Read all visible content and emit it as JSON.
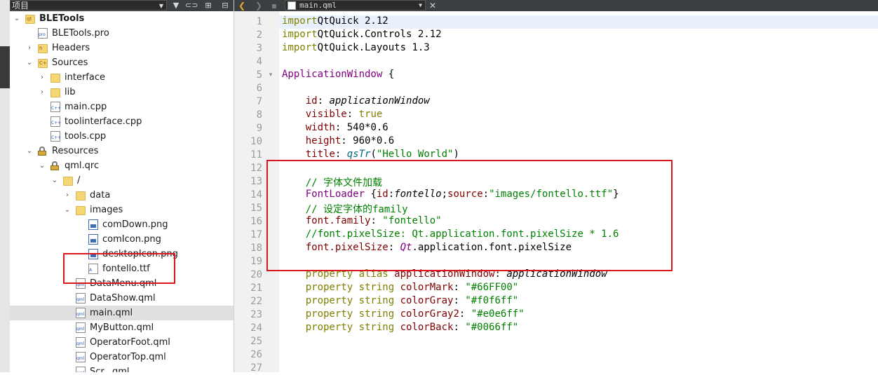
{
  "project_panel": {
    "title": "项目",
    "tree": [
      {
        "label": "BLETools",
        "depth": 0,
        "chev": "open",
        "icon": "project-icon",
        "bold": true
      },
      {
        "label": "BLETools.pro",
        "depth": 1,
        "chev": "none",
        "icon": "pro-file-icon"
      },
      {
        "label": "Headers",
        "depth": 1,
        "chev": "closed",
        "icon": "headers-icon"
      },
      {
        "label": "Sources",
        "depth": 1,
        "chev": "open",
        "icon": "sources-icon"
      },
      {
        "label": "interface",
        "depth": 2,
        "chev": "closed",
        "icon": "folder-icon"
      },
      {
        "label": "lib",
        "depth": 2,
        "chev": "closed",
        "icon": "folder-icon"
      },
      {
        "label": "main.cpp",
        "depth": 2,
        "chev": "none",
        "icon": "cpp-file-icon"
      },
      {
        "label": "toolinterface.cpp",
        "depth": 2,
        "chev": "none",
        "icon": "cpp-file-icon"
      },
      {
        "label": "tools.cpp",
        "depth": 2,
        "chev": "none",
        "icon": "cpp-file-icon"
      },
      {
        "label": "Resources",
        "depth": 1,
        "chev": "open",
        "icon": "resources-icon"
      },
      {
        "label": "qml.qrc",
        "depth": 2,
        "chev": "open",
        "icon": "qrc-file-icon"
      },
      {
        "label": "/",
        "depth": 3,
        "chev": "open",
        "icon": "folder-icon"
      },
      {
        "label": "data",
        "depth": 4,
        "chev": "closed",
        "icon": "folder-icon"
      },
      {
        "label": "images",
        "depth": 4,
        "chev": "open",
        "icon": "folder-icon"
      },
      {
        "label": "comDown.png",
        "depth": 5,
        "chev": "none",
        "icon": "image-file-icon"
      },
      {
        "label": "comIcon.png",
        "depth": 5,
        "chev": "none",
        "icon": "image-file-icon"
      },
      {
        "label": "desktopIcon.png",
        "depth": 5,
        "chev": "none",
        "icon": "image-file-icon"
      },
      {
        "label": "fontello.ttf",
        "depth": 5,
        "chev": "none",
        "icon": "font-file-icon"
      },
      {
        "label": "DataMenu.qml",
        "depth": 4,
        "chev": "none",
        "icon": "qml-file-icon"
      },
      {
        "label": "DataShow.qml",
        "depth": 4,
        "chev": "none",
        "icon": "qml-file-icon"
      },
      {
        "label": "main.qml",
        "depth": 4,
        "chev": "none",
        "icon": "qml-file-icon",
        "selected": true
      },
      {
        "label": "MyButton.qml",
        "depth": 4,
        "chev": "none",
        "icon": "qml-file-icon"
      },
      {
        "label": "OperatorFoot.qml",
        "depth": 4,
        "chev": "none",
        "icon": "qml-file-icon"
      },
      {
        "label": "OperatorTop.qml",
        "depth": 4,
        "chev": "none",
        "icon": "qml-file-icon"
      },
      {
        "label": "Scr...qml",
        "depth": 4,
        "chev": "none",
        "icon": "qml-file-icon"
      }
    ]
  },
  "editor": {
    "filename": "main.qml",
    "line_numbers": [
      "1",
      "2",
      "3",
      "4",
      "5",
      "6",
      "7",
      "8",
      "9",
      "10",
      "11",
      "12",
      "13",
      "14",
      "15",
      "16",
      "17",
      "18",
      "19",
      "20",
      "21",
      "22",
      "23",
      "24",
      "25",
      "26",
      "27"
    ],
    "fold_markers": {
      "5": "▾",
      "14": ""
    },
    "lines": [
      [
        [
          "kw",
          "import"
        ],
        [
          "",
          "QtQuick 2.12"
        ]
      ],
      [
        [
          "kw",
          "import"
        ],
        [
          "",
          "QtQuick.Controls 2.12"
        ]
      ],
      [
        [
          "kw",
          "import"
        ],
        [
          "",
          "QtQuick.Layouts 1.3"
        ]
      ],
      [],
      [
        [
          "ty",
          "ApplicationWindow"
        ],
        [
          "",
          " {"
        ]
      ],
      [],
      [
        [
          "",
          "    "
        ],
        [
          "pr",
          "id"
        ],
        [
          "",
          ": "
        ],
        [
          "it",
          "applicationWindow"
        ]
      ],
      [
        [
          "",
          "    "
        ],
        [
          "pr",
          "visible"
        ],
        [
          "",
          ": "
        ],
        [
          "kw",
          "true"
        ]
      ],
      [
        [
          "",
          "    "
        ],
        [
          "pr",
          "width"
        ],
        [
          "",
          ": 540*0.6"
        ]
      ],
      [
        [
          "",
          "    "
        ],
        [
          "pr",
          "height"
        ],
        [
          "",
          ": 960*0.6"
        ]
      ],
      [
        [
          "",
          "    "
        ],
        [
          "pr",
          "title"
        ],
        [
          "",
          ": "
        ],
        [
          "fn",
          "qsTr"
        ],
        [
          "",
          "("
        ],
        [
          "st",
          "\"Hello World\""
        ],
        [
          "",
          ")"
        ]
      ],
      [],
      [
        [
          "",
          "    "
        ],
        [
          "cm",
          "// 字体文件加载"
        ]
      ],
      [
        [
          "",
          "    "
        ],
        [
          "ty",
          "FontLoader"
        ],
        [
          "",
          " {"
        ],
        [
          "pr",
          "id"
        ],
        [
          "",
          ":"
        ],
        [
          "it",
          "fontello"
        ],
        [
          "",
          ";"
        ],
        [
          "pr",
          "source"
        ],
        [
          "",
          ":"
        ],
        [
          "st",
          "\"images/fontello.ttf\""
        ],
        [
          "",
          "}"
        ]
      ],
      [
        [
          "",
          "    "
        ],
        [
          "cm",
          "// 设定字体的family"
        ]
      ],
      [
        [
          "",
          "    "
        ],
        [
          "pr",
          "font.family"
        ],
        [
          "",
          ": "
        ],
        [
          "st",
          "\"fontello\""
        ]
      ],
      [
        [
          "",
          "    "
        ],
        [
          "cm",
          "//font.pixelSize: Qt.application.font.pixelSize * 1.6"
        ]
      ],
      [
        [
          "",
          "    "
        ],
        [
          "pr",
          "font.pixelSize"
        ],
        [
          "",
          ": "
        ],
        [
          "ty it",
          "Qt"
        ],
        [
          "",
          ".application.font.pixelSize"
        ]
      ],
      [],
      [
        [
          "",
          "    "
        ],
        [
          "kw",
          "property alias"
        ],
        [
          "",
          " "
        ],
        [
          "pr",
          "applicationWindow"
        ],
        [
          "",
          ": "
        ],
        [
          "it",
          "applicationWindow"
        ]
      ],
      [
        [
          "",
          "    "
        ],
        [
          "kw",
          "property string"
        ],
        [
          "",
          " "
        ],
        [
          "pr",
          "colorMark"
        ],
        [
          "",
          ": "
        ],
        [
          "st",
          "\"#66FF00\""
        ]
      ],
      [
        [
          "",
          "    "
        ],
        [
          "kw",
          "property string"
        ],
        [
          "",
          " "
        ],
        [
          "pr",
          "colorGray"
        ],
        [
          "",
          ": "
        ],
        [
          "st",
          "\"#f0f6ff\""
        ]
      ],
      [
        [
          "",
          "    "
        ],
        [
          "kw",
          "property string"
        ],
        [
          "",
          " "
        ],
        [
          "pr",
          "colorGray2"
        ],
        [
          "",
          ": "
        ],
        [
          "st",
          "\"#e0e6ff\""
        ]
      ],
      [
        [
          "",
          "    "
        ],
        [
          "kw",
          "property string"
        ],
        [
          "",
          " "
        ],
        [
          "pr",
          "colorBack"
        ],
        [
          "",
          ": "
        ],
        [
          "st",
          "\"#0066ff\""
        ]
      ],
      [],
      [],
      []
    ]
  },
  "colors": {
    "highlight_box": "#d9161c",
    "selection": "#e0e0e0",
    "current_line": "#e8f0fb"
  }
}
